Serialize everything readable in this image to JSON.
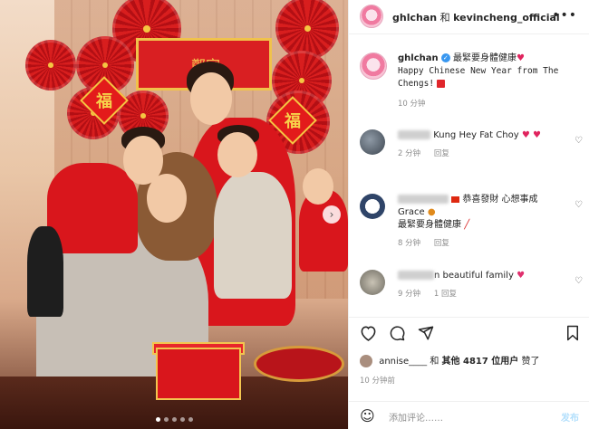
{
  "header": {
    "user1": "ghlchan",
    "joiner": "和",
    "user2": "kevincheng_official",
    "more_icon": "more-horizontal-icon"
  },
  "caption": {
    "username": "ghlchan",
    "text_cn": "最緊要身體健康",
    "text_en": "Happy Chinese New Year from The Chengs!",
    "time": "10 分钟"
  },
  "comments": [
    {
      "text": "Kung Hey Fat Choy",
      "time": "2 分钟",
      "reply": "回复"
    },
    {
      "text": "恭喜發財 心想事成",
      "text2": "Grace",
      "text3": "最緊要身體健康",
      "time": "8 分钟",
      "reply": "回复"
    },
    {
      "user_visible_part": "n",
      "text": "beautiful family",
      "time": "9 分钟",
      "reply": "1 回复"
    }
  ],
  "actions": {
    "like_icon": "heart-icon",
    "comment_icon": "comment-icon",
    "share_icon": "send-icon",
    "save_icon": "bookmark-icon"
  },
  "likes": {
    "user": "annise____",
    "joiner": "和",
    "others": "其他 4817 位用户",
    "suffix": "赞了"
  },
  "post_time": "10 分钟前",
  "add_comment": {
    "placeholder": "添加评论……",
    "post_label": "发布"
  },
  "carousel": {
    "total_dots": 5,
    "active_index": 0
  },
  "photo": {
    "fu_char": "福",
    "banner_text": "鄭宅"
  }
}
